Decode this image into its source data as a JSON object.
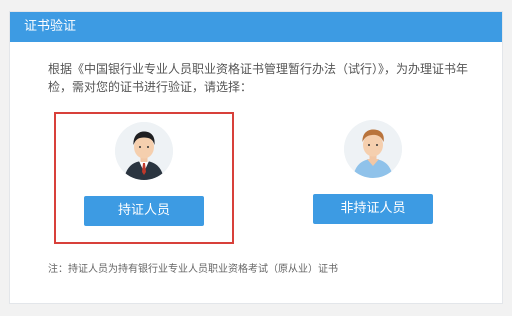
{
  "header": {
    "title": "证书验证"
  },
  "intro": {
    "text": "根据《中国银行业专业人员职业资格证书管理暂行办法（试行）》，为办理证书年检，需对您的证书进行验证，请选择："
  },
  "options": [
    {
      "label": "持证人员",
      "icon": "male-suit-avatar-icon"
    },
    {
      "label": "非持证人员",
      "icon": "male-casual-avatar-icon"
    }
  ],
  "note": "注：持证人员为持有银行业专业人员职业资格考试（原从业）证书",
  "colors": {
    "accent": "#3d9be3",
    "highlight_border": "#d8403a"
  }
}
